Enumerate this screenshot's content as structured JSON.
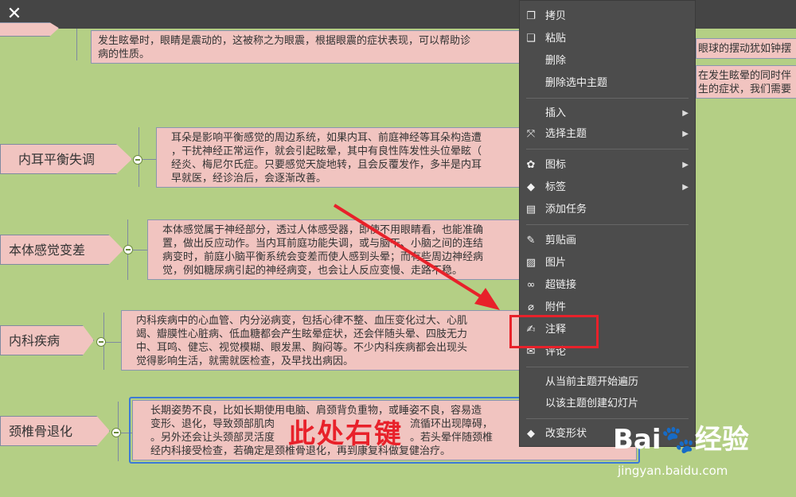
{
  "window": {
    "close_glyph": "✕"
  },
  "topics": [
    {
      "label": "内耳平衡失调"
    },
    {
      "label": "本体感觉变差"
    },
    {
      "label": "内科疾病"
    },
    {
      "label": "颈椎骨退化"
    }
  ],
  "notes": {
    "n0": [
      "发生眩晕时，眼睛是震动的，这被称之为眼震，根据眼震的症状表现，可以帮助诊",
      "病的性质。"
    ],
    "n1": [
      "耳朵是影响平衡感觉的周边系统，如果内耳、前庭神经等耳朵构造遭",
      "，干扰神经正常运作，就会引起眩晕，其中有良性阵发性头位晕眩（",
      "经炎、梅尼尔氏症。只要感觉天旋地转，且会反覆发作，多半是内耳",
      "早就医，经诊治后，会逐渐改善。"
    ],
    "n2": [
      "本体感觉属于神经部分，透过人体感受器，即使不用眼睛看，也能准确",
      "置，做出反应动作。当内耳前庭功能失调，或与脑干、小脑之间的连结",
      "病变时，前庭小脑平衡系统会变差而使人感到头晕；而有些周边神经病",
      "觉，例如糖尿病引起的神经病变，也会让人反应变慢、走路不稳。"
    ],
    "n3": [
      "内科疾病中的心血管、内分泌病变，包括心律不整、血压变化过大、心肌",
      "竭、瓣膜性心脏病、低血糖都会产生眩晕症状，还会伴随头晕、四肢无力",
      "中、耳鸣、健忘、视觉模糊、眼发黑、胸闷等。不少内科疾病都会出现头",
      "觉得影响生活，就需就医检查，及早找出病因。"
    ],
    "n4": [
      "长期姿势不良，比如长期使用电脑、肩颈背负重物，或睡姿不良，容易造",
      "变形、退化，导致颈部肌肉",
      "流循环出现障碍，",
      "。另外还会让头颈部灵活度",
      "。若头晕伴随颈椎",
      "经内科接受检查，若确定是颈椎骨退化，再到康复科做复健治疗。"
    ],
    "right1": "眼球的摆动犹如钟摆",
    "right2": [
      "在发生眩晕的同时伴",
      "生的症状，我们需要"
    ]
  },
  "menu": {
    "items": [
      {
        "label": "拷贝",
        "icon": "copy-icon",
        "glyph": "❐"
      },
      {
        "label": "粘贴",
        "icon": "paste-icon",
        "glyph": "❑"
      },
      {
        "label": "删除",
        "icon": "",
        "glyph": ""
      },
      {
        "label": "删除选中主题",
        "icon": "",
        "glyph": ""
      },
      {
        "label": "插入",
        "icon": "",
        "glyph": "",
        "arrow": "▶"
      },
      {
        "label": "选择主题",
        "icon": "select-topic-icon",
        "glyph": "⤧",
        "arrow": "▶"
      },
      {
        "label": "图标",
        "icon": "star-icon",
        "glyph": "✿",
        "arrow": "▶"
      },
      {
        "label": "标签",
        "icon": "tag-icon",
        "glyph": "◆",
        "arrow": "▶"
      },
      {
        "label": "添加任务",
        "icon": "task-icon",
        "glyph": "▤"
      },
      {
        "label": "剪贴画",
        "icon": "clipart-icon",
        "glyph": "✎"
      },
      {
        "label": "图片",
        "icon": "image-icon",
        "glyph": "▨"
      },
      {
        "label": "超链接",
        "icon": "link-icon",
        "glyph": "∞"
      },
      {
        "label": "附件",
        "icon": "attachment-icon",
        "glyph": "⌀"
      },
      {
        "label": "注释",
        "icon": "note-icon",
        "glyph": "✍"
      },
      {
        "label": "评论",
        "icon": "comment-icon",
        "glyph": "✉"
      },
      {
        "label": "从当前主题开始遍历",
        "icon": "",
        "glyph": ""
      },
      {
        "label": "以该主题创建幻灯片",
        "icon": "",
        "glyph": ""
      },
      {
        "label": "改变形状",
        "icon": "shape-icon",
        "glyph": "◆"
      }
    ]
  },
  "annotation": {
    "text": "此处右键",
    "color": "#e8212a"
  },
  "watermark": {
    "logo": "Bai🐾经验",
    "url": "jingyan.baidu.com"
  }
}
